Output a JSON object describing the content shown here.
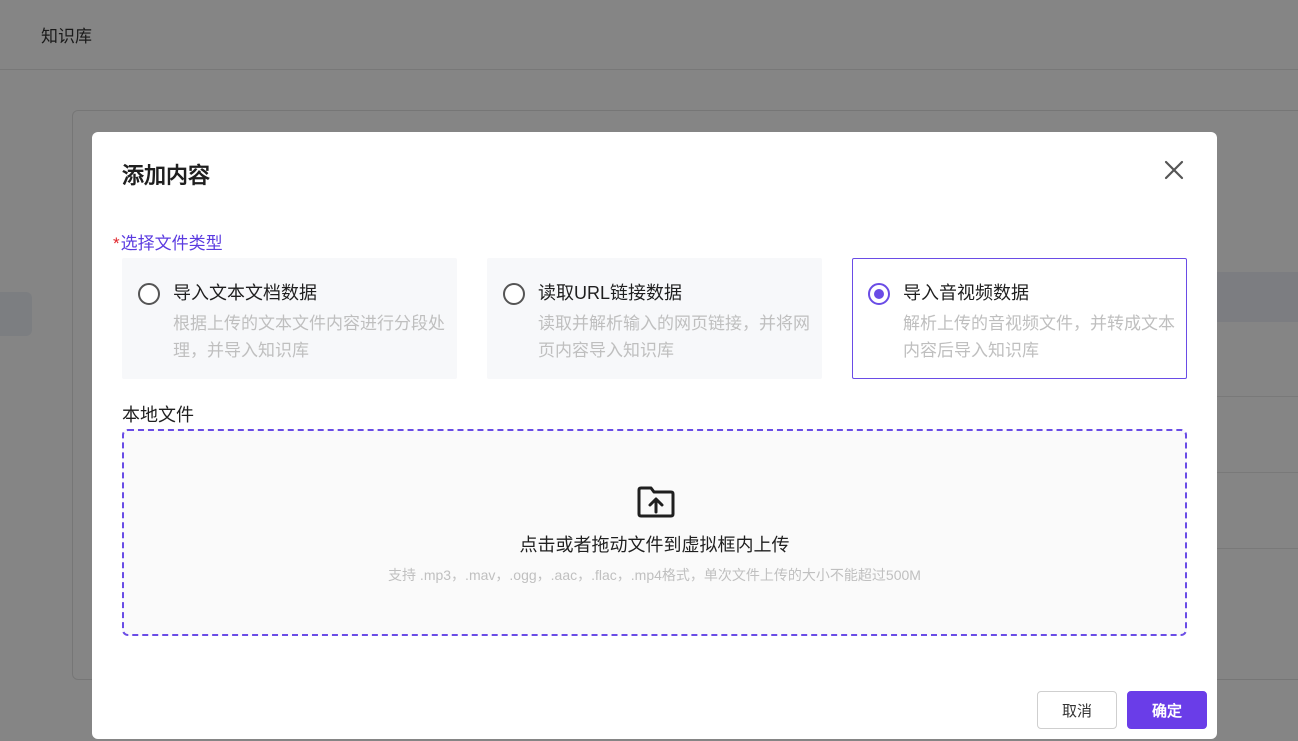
{
  "page": {
    "header_title": "知识库"
  },
  "modal": {
    "title": "添加内容",
    "close_icon": "close-icon",
    "file_type_label": "选择文件类型",
    "required_mark": "*",
    "options": [
      {
        "title": "导入文本文档数据",
        "desc": "根据上传的文本文件内容进行分段处理，并导入知识库",
        "selected": false
      },
      {
        "title": "读取URL链接数据",
        "desc": "读取并解析输入的网页链接，并将网页内容导入知识库",
        "selected": false
      },
      {
        "title": "导入音视频数据",
        "desc": "解析上传的音视频文件，并转成文本内容后导入知识库",
        "selected": true
      }
    ],
    "local_file_label": "本地文件",
    "dropzone": {
      "icon": "folder-upload-icon",
      "main_text": "点击或者拖动文件到虚拟框内上传",
      "hint_text": "支持 .mp3，.mav，.ogg，.aac，.flac，.mp4格式，单次文件上传的大小不能超过500M"
    },
    "buttons": {
      "cancel": "取消",
      "ok": "确定"
    }
  },
  "colors": {
    "accent": "#6a3de8",
    "required": "#e0242a",
    "muted_text": "#bfbfbf"
  }
}
